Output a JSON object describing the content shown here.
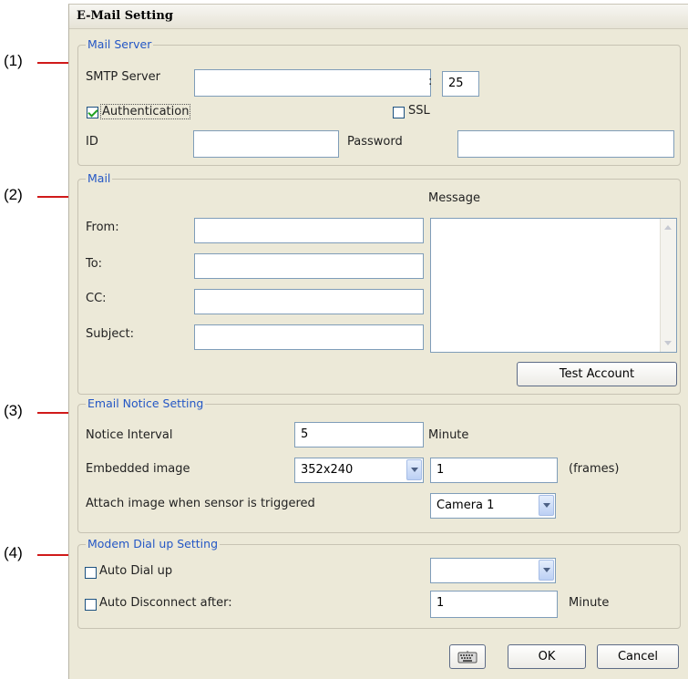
{
  "callouts": [
    "(1)",
    "(2)",
    "(3)",
    "(4)"
  ],
  "window": {
    "title": "E-Mail Setting"
  },
  "mail_server": {
    "group_title": "Mail Server",
    "smtp_label": "SMTP Server",
    "smtp_value": "",
    "port_separator": ":",
    "port_value": "25",
    "authentication_label": "Authentication",
    "authentication_checked": true,
    "ssl_label": "SSL",
    "ssl_checked": false,
    "id_label": "ID",
    "id_value": "",
    "password_label": "Password",
    "password_value": ""
  },
  "mail": {
    "group_title": "Mail",
    "message_label": "Message",
    "from_label": "From:",
    "to_label": "To:",
    "cc_label": "CC:",
    "subject_label": "Subject:",
    "test_account_label": "Test Account"
  },
  "notice": {
    "group_title": "Email Notice Setting",
    "interval_label": "Notice Interval",
    "interval_value": "5",
    "interval_unit": "Minute",
    "embedded_label": "Embedded image",
    "embedded_size": "352x240",
    "embedded_frames": "1",
    "frames_unit": "(frames)",
    "attach_label": "Attach image when sensor is triggered",
    "attach_camera": "Camera 1"
  },
  "modem": {
    "group_title": "Modem Dial up Setting",
    "auto_dial_label": "Auto Dial up",
    "auto_dial_checked": false,
    "dial_select_value": "",
    "auto_disconnect_label": "Auto Disconnect after:",
    "auto_disconnect_checked": false,
    "disconnect_value": "1",
    "disconnect_unit": "Minute"
  },
  "footer": {
    "keyboard_icon": "keyboard-icon",
    "ok_label": "OK",
    "cancel_label": "Cancel"
  }
}
